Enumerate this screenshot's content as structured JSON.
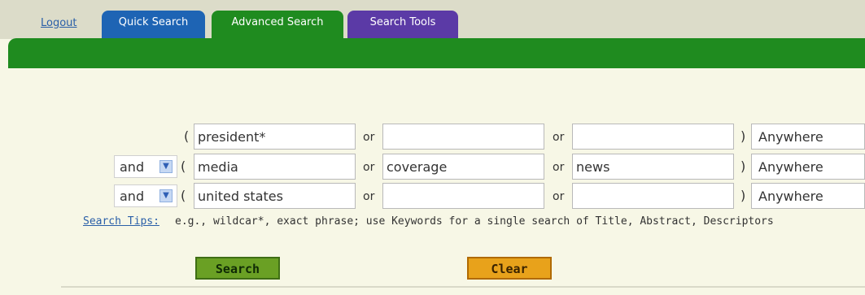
{
  "nav": {
    "logout_label": "Logout",
    "tabs": [
      {
        "label": "Quick Search"
      },
      {
        "label": "Advanced Search"
      },
      {
        "label": "Search Tools"
      }
    ]
  },
  "form": {
    "rows": [
      {
        "bool": "",
        "term1": "president*",
        "term2": "",
        "term3": "",
        "scope": "Anywhere"
      },
      {
        "bool": "and",
        "term1": "media",
        "term2": "coverage",
        "term3": "news",
        "scope": "Anywhere"
      },
      {
        "bool": "and",
        "term1": "united states",
        "term2": "",
        "term3": "",
        "scope": "Anywhere"
      }
    ],
    "or_label": "or",
    "open_paren": "(",
    "close_paren": ")",
    "tips_link": "Search Tips:",
    "tips_text": "e.g., wildcar*, exact phrase; use Keywords for a single search of Title, Abstract, Descriptors",
    "search_label": "Search",
    "clear_label": "Clear"
  },
  "colors": {
    "green_band": "#1f8b1f",
    "quick_tab": "#1e64b4",
    "tools_tab": "#5b3aa6",
    "search_button": "#6aa024",
    "clear_button": "#e8a21b"
  }
}
